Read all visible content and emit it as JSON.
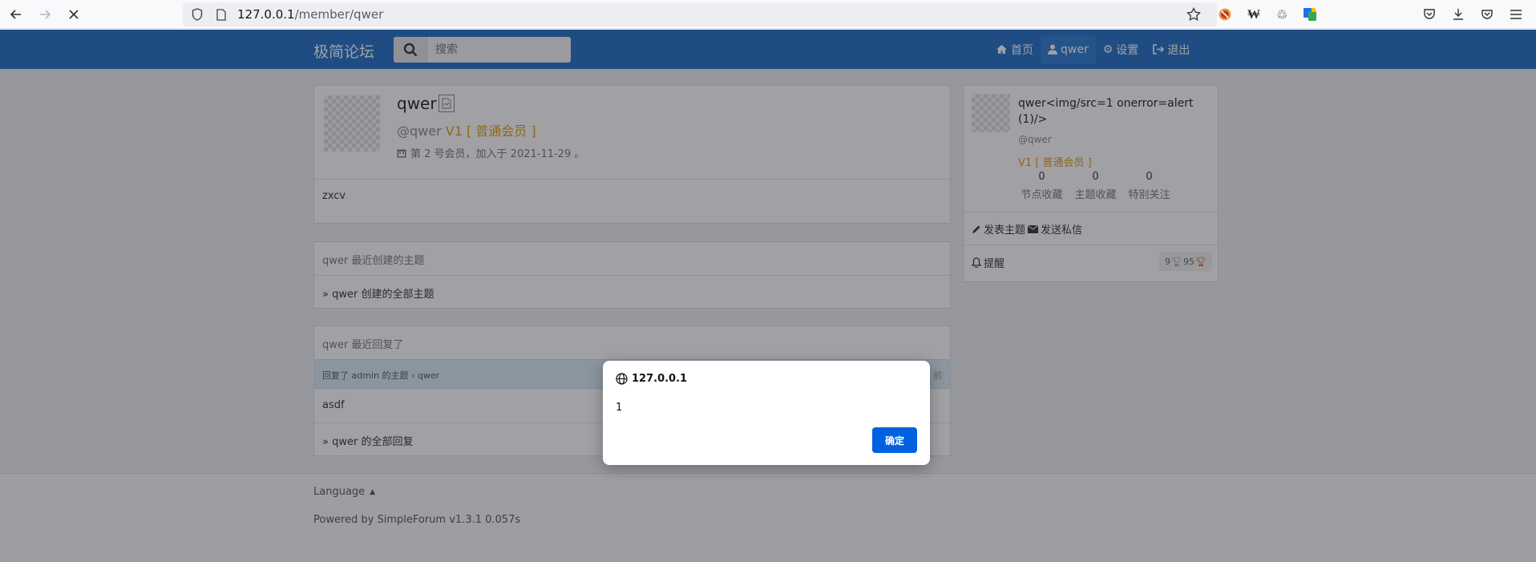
{
  "browser": {
    "url_host": "127.0.0.1",
    "url_path": "/member/qwer"
  },
  "nav": {
    "brand": "极简论坛",
    "search_placeholder": "搜索",
    "links": {
      "home": "首页",
      "user": "qwer",
      "settings": "设置",
      "logout": "退出"
    }
  },
  "profile": {
    "username": "qwer",
    "handle": "@qwer",
    "level": "V1 [ 普通会员 ]",
    "member_info": "第 2 号会员，加入于 2021-11-29 。",
    "bio": "zxcv"
  },
  "topics": {
    "header": "qwer 最近创建的主题",
    "all_link": "» qwer 创建的全部主题"
  },
  "replies": {
    "header": "qwer 最近回复了",
    "row_meta": "回复了 admin 的主题 › qwer",
    "row_time": "前",
    "content": "asdf",
    "all_link": "» qwer 的全部回复"
  },
  "sidebar": {
    "display_name": "qwer<img/src=1 onerror=alert(1)/>",
    "handle": "@qwer",
    "level": "V1 [ 普通会员 ]",
    "stats": [
      {
        "value": "0",
        "label": "节点收藏"
      },
      {
        "value": "0",
        "label": "主题收藏"
      },
      {
        "value": "0",
        "label": "特别关注"
      }
    ],
    "new_topic": "发表主题",
    "send_message": "发送私信",
    "notifications": "提醒",
    "silver": "9",
    "gold": "95"
  },
  "footer": {
    "language": "Language",
    "powered": "Powered by SimpleForum v1.3.1 0.057s"
  },
  "dialog": {
    "title": "127.0.0.1",
    "message": "1",
    "ok": "确定"
  }
}
